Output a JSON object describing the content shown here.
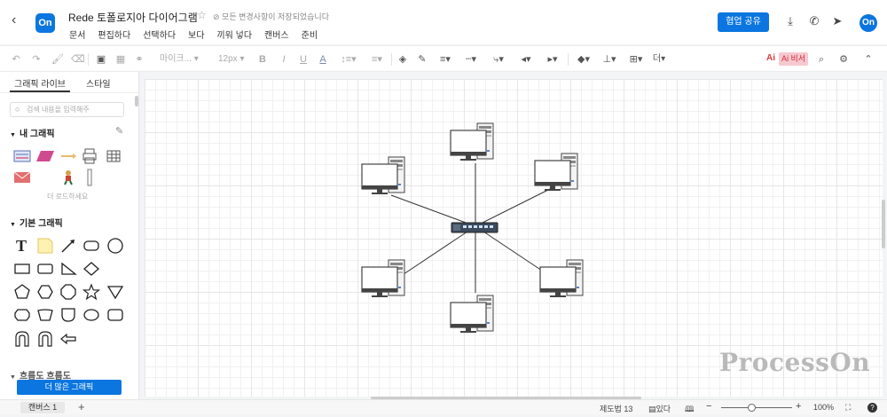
{
  "app": {
    "doc_title": "Rede 토폴로지아 다이어그램",
    "save_status": "모든 변경사항이 저장되었습니다",
    "logo_text": "On",
    "share_label": "협업 공유",
    "avatar_text": "On"
  },
  "menu": [
    "문서",
    "편집하다",
    "선택하다",
    "보다",
    "끼워 넣다",
    "캔버스",
    "준비"
  ],
  "toolbar": {
    "font_name": "마이크...",
    "font_size": "12px",
    "more_label": "더",
    "ai_label": "Ai",
    "ai_helper_label": "Ai 비서"
  },
  "sidebar": {
    "tabs": [
      "그래픽 라이브",
      "스타일"
    ],
    "search_placeholder": "검색 내용을 입력해주",
    "my_shapes_title": "내 그래픽",
    "load_more": "더 로드하세요",
    "basic_shapes_title": "기본 그래픽",
    "flowchart_title": "흐름도 흐름도",
    "more_shapes_button": "더 많은 그래픽"
  },
  "diagram": {
    "nodes": [
      "computer-top",
      "computer-top-right",
      "computer-bottom-right",
      "computer-bottom",
      "computer-bottom-left",
      "computer-top-left"
    ],
    "hub": "network-switch"
  },
  "watermark": "ProcessOn",
  "status": {
    "canvas_tab": "캔버스 1",
    "shape_count": "제도법 13",
    "view_label": "있다",
    "zoom": "100%"
  },
  "colors": {
    "accent": "#0b76e0",
    "ai": "#d52b3a"
  }
}
